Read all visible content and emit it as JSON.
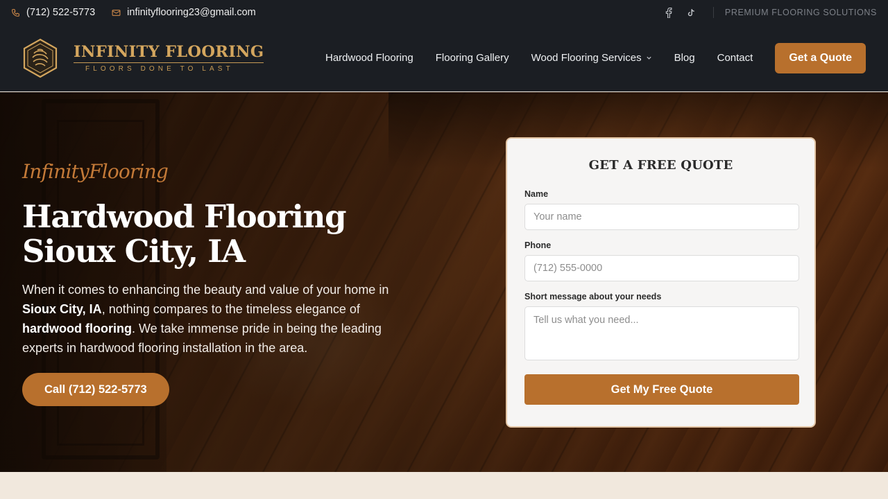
{
  "topbar": {
    "phone": "(712) 522-5773",
    "email": "infinityflooring23@gmail.com",
    "social": [
      "facebook-icon",
      "tiktok-icon"
    ],
    "tagline": "PREMIUM FLOORING SOLUTIONS"
  },
  "header": {
    "logo_title": "INFINITY FLOORING",
    "logo_subtitle": "FLOORS DONE TO LAST",
    "nav": [
      {
        "label": "Hardwood Flooring"
      },
      {
        "label": "Flooring Gallery"
      },
      {
        "label": "Wood Flooring Services",
        "has_dropdown": true
      },
      {
        "label": "Blog"
      },
      {
        "label": "Contact"
      }
    ],
    "cta": "Get a Quote"
  },
  "hero": {
    "brand": "InfinityFlooring",
    "title": "Hardwood Flooring Sioux City, IA",
    "desc_part1": "When it comes to enhancing the beauty and value of your home in ",
    "desc_bold1": "Sioux City, IA",
    "desc_part2": ", nothing compares to the timeless elegance of ",
    "desc_bold2": "hardwood flooring",
    "desc_part3": ". We take immense pride in being the leading experts in hardwood flooring installation in the area.",
    "call_button": "Call (712) 522-5773"
  },
  "form": {
    "title": "GET A FREE QUOTE",
    "name_label": "Name",
    "name_placeholder": "Your name",
    "phone_label": "Phone",
    "phone_placeholder": "(712) 555-0000",
    "message_label": "Short message about your needs",
    "message_placeholder": "Tell us what you need...",
    "submit": "Get My Free Quote"
  },
  "colors": {
    "accent": "#b8702d",
    "gold": "#d4a65e",
    "dark": "#1b1e23",
    "cream": "#f1e8dd"
  }
}
